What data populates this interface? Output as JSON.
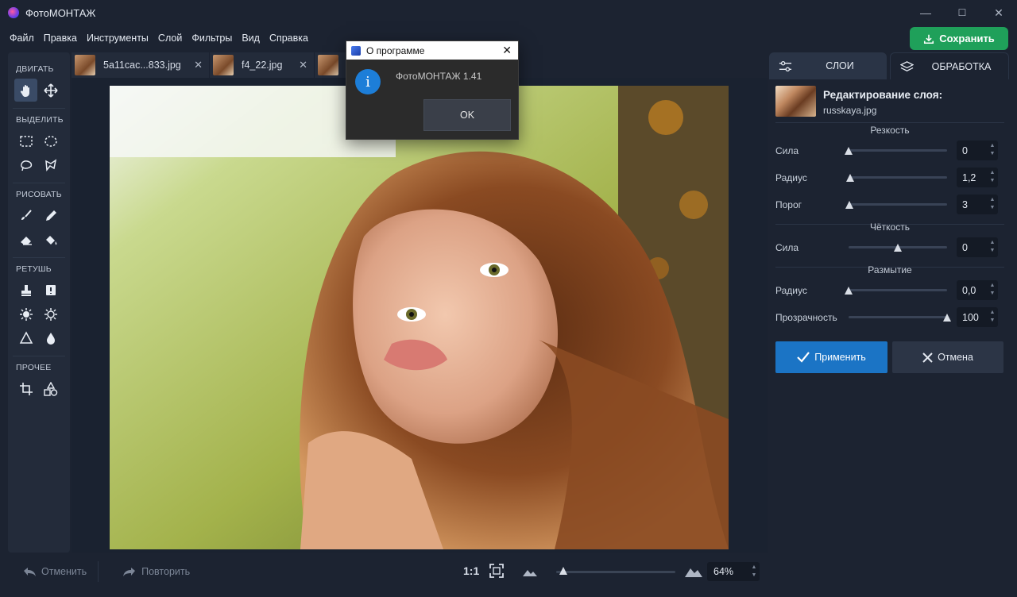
{
  "app": {
    "title": "ФотоМОНТАЖ"
  },
  "window_controls": {
    "minimize": "—",
    "maximize": "☐",
    "close": "✕"
  },
  "menu": [
    "Файл",
    "Правка",
    "Инструменты",
    "Слой",
    "Фильтры",
    "Вид",
    "Справка"
  ],
  "save_button": {
    "label": "Сохранить",
    "color": "#1fa05a"
  },
  "toolbar": {
    "groups": [
      {
        "title": "ДВИГАТЬ",
        "tools": [
          "hand-icon",
          "move-icon"
        ]
      },
      {
        "title": "ВЫДЕЛИТЬ",
        "tools": [
          "rect-select-icon",
          "ellipse-select-icon",
          "lasso-icon",
          "polygon-lasso-icon"
        ]
      },
      {
        "title": "РИСОВАТЬ",
        "tools": [
          "brush-icon",
          "pencil-icon",
          "eraser-icon",
          "fill-icon"
        ]
      },
      {
        "title": "РЕТУШЬ",
        "tools": [
          "stamp-icon",
          "patch-icon",
          "brighten-icon",
          "darken-icon",
          "sharpen-icon",
          "blur-drop-icon"
        ]
      },
      {
        "title": "ПРОЧЕЕ",
        "tools": [
          "crop-icon",
          "shapes-icon"
        ]
      }
    ],
    "active_tool": "hand-icon"
  },
  "tabs": [
    {
      "label": "5a11cac...833.jpg"
    },
    {
      "label": "f4_22.jpg"
    },
    {
      "label": ""
    }
  ],
  "bottombar": {
    "undo": "Отменить",
    "redo": "Повторить",
    "one_to_one": "1:1",
    "zoom_value": "64%",
    "zoom_level": 0.06
  },
  "panel": {
    "tabs": [
      {
        "label": "СЛОИ",
        "icon": "sliders-icon"
      },
      {
        "label": "ОБРАБОТКА",
        "icon": "layers-icon"
      }
    ],
    "layer_title": "Редактирование слоя:",
    "layer_file": "russkaya.jpg",
    "sections": {
      "sharpness": "Резкость",
      "clarity": "Чёткость",
      "blur": "Размытие"
    },
    "props": {
      "sharp_strength": {
        "label": "Сила",
        "value": "0",
        "level": 0.0
      },
      "sharp_radius": {
        "label": "Радиус",
        "value": "1,2",
        "level": 0.02
      },
      "sharp_threshold": {
        "label": "Порог",
        "value": "3",
        "level": 0.01
      },
      "clarity_strength": {
        "label": "Сила",
        "value": "0",
        "level": 0.5
      },
      "blur_radius": {
        "label": "Радиус",
        "value": "0,0",
        "level": 0.0
      },
      "blur_opacity": {
        "label": "Прозрачность",
        "value": "100",
        "level": 1.0
      }
    },
    "apply": "Применить",
    "cancel": "Отмена"
  },
  "dialog": {
    "title": "О программе",
    "message": "ФотоМОНТАЖ 1.41",
    "ok": "OK"
  }
}
